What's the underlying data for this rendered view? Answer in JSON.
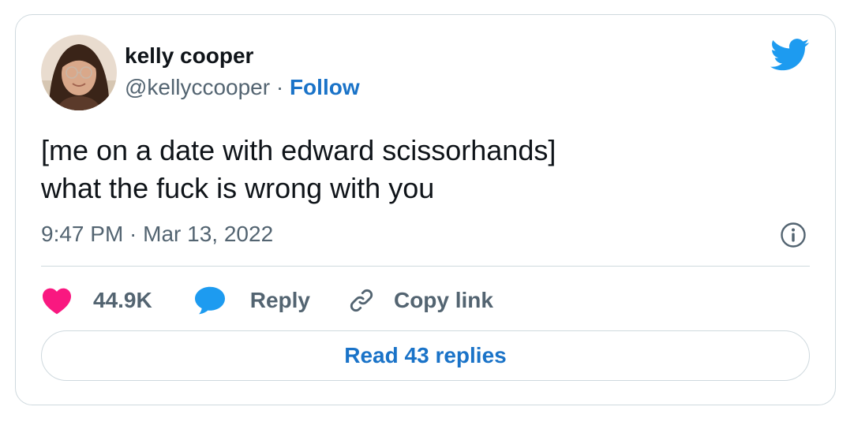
{
  "author": {
    "name": "kelly cooper",
    "handle": "@kellyccooper",
    "separator": "·",
    "follow_label": "Follow"
  },
  "tweet": {
    "text": "[me on a date with edward scissorhands]\nwhat the fuck is wrong with you",
    "timestamp": "9:47 PM · Mar 13, 2022"
  },
  "actions": {
    "likes": "44.9K",
    "reply_label": "Reply",
    "copy_link_label": "Copy link"
  },
  "footer": {
    "read_replies_label": "Read 43 replies"
  },
  "colors": {
    "like_heart": "#f91880",
    "reply_bubble": "#1d9bf0",
    "twitter_blue": "#1d9bf0",
    "link_blue": "#1a73c8",
    "muted_text": "#536471",
    "border": "#cfd9de"
  },
  "icons": {
    "logo": "twitter-bird-icon",
    "info": "info-icon",
    "like": "heart-icon",
    "reply": "speech-bubble-icon",
    "copy": "link-icon"
  }
}
